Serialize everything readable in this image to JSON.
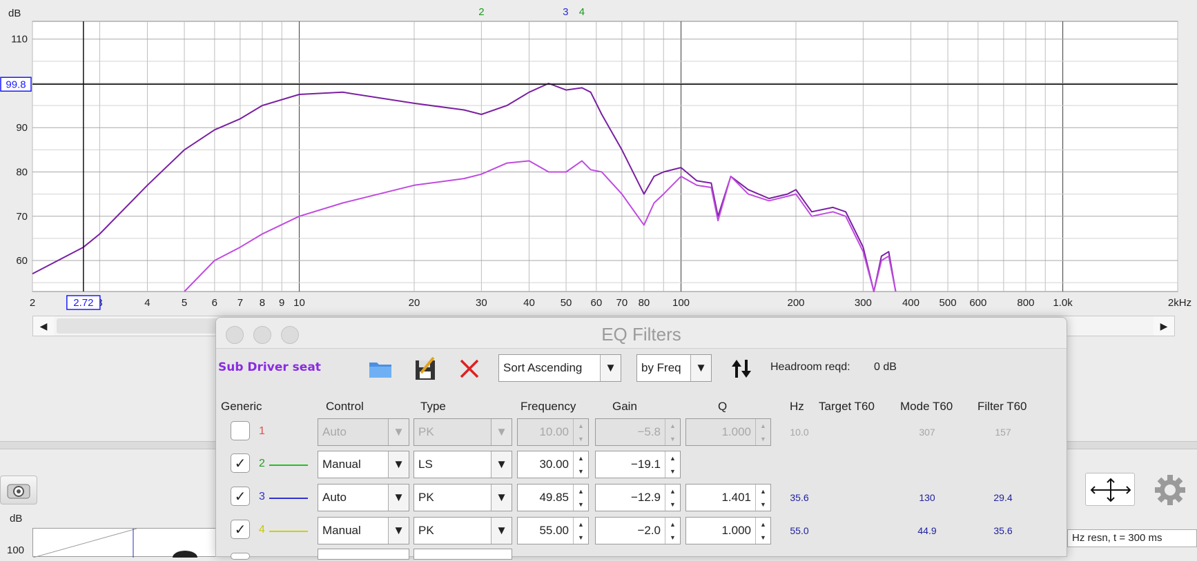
{
  "graph": {
    "y_unit": "dB",
    "y_ticks": [
      {
        "value": 110,
        "label": "110"
      },
      {
        "value": 90,
        "label": "90"
      },
      {
        "value": 80,
        "label": "80"
      },
      {
        "value": 70,
        "label": "70"
      },
      {
        "value": 60,
        "label": "60"
      }
    ],
    "y_cursor": "99.8",
    "x_ticks": [
      {
        "value": 2,
        "label": "2"
      },
      {
        "value": 3,
        "label": "3"
      },
      {
        "value": 4,
        "label": "4"
      },
      {
        "value": 5,
        "label": "5"
      },
      {
        "value": 6,
        "label": "6"
      },
      {
        "value": 7,
        "label": "7"
      },
      {
        "value": 8,
        "label": "8"
      },
      {
        "value": 9,
        "label": "9"
      },
      {
        "value": 10,
        "label": "10"
      },
      {
        "value": 20,
        "label": "20"
      },
      {
        "value": 30,
        "label": "30"
      },
      {
        "value": 40,
        "label": "40"
      },
      {
        "value": 50,
        "label": "50"
      },
      {
        "value": 60,
        "label": "60"
      },
      {
        "value": 70,
        "label": "70"
      },
      {
        "value": 80,
        "label": "80"
      },
      {
        "value": 100,
        "label": "100"
      },
      {
        "value": 200,
        "label": "200"
      },
      {
        "value": 300,
        "label": "300"
      },
      {
        "value": 400,
        "label": "400"
      },
      {
        "value": 500,
        "label": "500"
      },
      {
        "value": 600,
        "label": "600"
      },
      {
        "value": 800,
        "label": "800"
      },
      {
        "value": 1000,
        "label": "1.0k"
      },
      {
        "value": 2000,
        "label": "2kHz"
      }
    ],
    "x_cursor": "2.72",
    "filter_markers": [
      {
        "label": "2",
        "freq": 30,
        "color": "#1a9a1a"
      },
      {
        "label": "3",
        "freq": 49.85,
        "color": "#2a2acc"
      },
      {
        "label": "4",
        "freq": 55,
        "color": "#1a9a1a"
      }
    ],
    "colors": {
      "upper_trace": "#7a1fa2",
      "lower_trace": "#c04ae0"
    }
  },
  "chart_data": {
    "type": "line",
    "xlabel": "",
    "ylabel": "dB",
    "x_scale": "log",
    "xlim": [
      2,
      2000
    ],
    "ylim": [
      53,
      114
    ],
    "grid": true,
    "series": [
      {
        "values": [
          [
            2,
            57
          ],
          [
            2.72,
            63
          ],
          [
            3,
            66
          ],
          [
            4,
            77
          ],
          [
            5,
            85
          ],
          [
            6,
            89.5
          ],
          [
            7,
            92
          ],
          [
            8,
            95
          ],
          [
            10,
            97.5
          ],
          [
            13,
            98
          ],
          [
            20,
            95.5
          ],
          [
            27,
            94
          ],
          [
            30,
            93
          ],
          [
            35,
            95
          ],
          [
            40,
            98
          ],
          [
            45,
            100
          ],
          [
            50,
            98.5
          ],
          [
            55,
            99
          ],
          [
            58,
            98
          ],
          [
            62,
            93
          ],
          [
            70,
            85
          ],
          [
            80,
            75
          ],
          [
            85,
            79
          ],
          [
            90,
            80
          ],
          [
            100,
            81
          ],
          [
            110,
            78
          ],
          [
            120,
            77.5
          ],
          [
            125,
            70
          ],
          [
            135,
            79
          ],
          [
            150,
            76
          ],
          [
            170,
            74
          ],
          [
            190,
            75
          ],
          [
            200,
            76
          ],
          [
            220,
            71
          ],
          [
            250,
            72
          ],
          [
            270,
            71
          ],
          [
            300,
            63
          ],
          [
            320,
            53
          ],
          [
            335,
            61
          ],
          [
            350,
            62
          ],
          [
            365,
            53
          ]
        ]
      },
      {
        "values": [
          [
            5,
            53
          ],
          [
            6,
            60
          ],
          [
            7,
            63
          ],
          [
            8,
            66
          ],
          [
            10,
            70
          ],
          [
            13,
            73
          ],
          [
            20,
            77
          ],
          [
            27,
            78.5
          ],
          [
            30,
            79.5
          ],
          [
            35,
            82
          ],
          [
            40,
            82.5
          ],
          [
            45,
            80
          ],
          [
            50,
            80
          ],
          [
            55,
            82.5
          ],
          [
            58,
            80.5
          ],
          [
            62,
            80
          ],
          [
            70,
            75
          ],
          [
            80,
            68
          ],
          [
            85,
            73
          ],
          [
            90,
            75
          ],
          [
            100,
            79
          ],
          [
            110,
            77
          ],
          [
            120,
            76.5
          ],
          [
            125,
            69
          ],
          [
            135,
            79
          ],
          [
            150,
            75
          ],
          [
            170,
            73.5
          ],
          [
            190,
            74.5
          ],
          [
            200,
            75
          ],
          [
            220,
            70
          ],
          [
            250,
            71
          ],
          [
            270,
            70
          ],
          [
            300,
            62
          ],
          [
            320,
            53
          ],
          [
            335,
            60
          ],
          [
            350,
            61
          ],
          [
            365,
            53
          ]
        ]
      }
    ]
  },
  "dialog": {
    "title": "EQ Filters",
    "measurement_name": "Sub Driver seat",
    "sort_order": "Sort Ascending",
    "sort_by": "by Freq",
    "headroom_label": "Headroom reqd:",
    "headroom_value": "0 dB",
    "headers": {
      "generic": "Generic",
      "control": "Control",
      "type": "Type",
      "frequency": "Frequency",
      "gain": "Gain",
      "q": "Q",
      "hz": "Hz",
      "target_t60": "Target T60",
      "mode_t60": "Mode T60",
      "filter_t60": "Filter T60"
    },
    "filters": [
      {
        "num": "1",
        "checked": false,
        "line_color": "",
        "num_color": "#e05050",
        "control": "Auto",
        "type": "PK",
        "frequency": "10.00",
        "gain": "−5.8",
        "q": "1.000",
        "hz": "10.0",
        "target_t60": "",
        "mode_t60": "307",
        "filter_t60": "157",
        "disabled": true
      },
      {
        "num": "2",
        "checked": true,
        "line_color": "#22c022",
        "num_color": "#22a022",
        "control": "Manual",
        "type": "LS",
        "frequency": "30.00",
        "gain": "−19.1",
        "q": "",
        "hz": "",
        "target_t60": "",
        "mode_t60": "",
        "filter_t60": "",
        "disabled": false
      },
      {
        "num": "3",
        "checked": true,
        "line_color": "#3030d0",
        "num_color": "#3030d0",
        "control": "Auto",
        "type": "PK",
        "frequency": "49.85",
        "gain": "−12.9",
        "q": "1.401",
        "hz": "35.6",
        "target_t60": "",
        "mode_t60": "130",
        "filter_t60": "29.4",
        "disabled": false
      },
      {
        "num": "4",
        "checked": true,
        "line_color": "#d0d000",
        "num_color": "#c8c800",
        "control": "Manual",
        "type": "PK",
        "frequency": "55.00",
        "gain": "−2.0",
        "q": "1.000",
        "hz": "55.0",
        "target_t60": "",
        "mode_t60": "44.9",
        "filter_t60": "35.6",
        "disabled": false
      }
    ]
  },
  "lower": {
    "y_unit": "dB",
    "y_tick": "100",
    "resolution_text": "Hz resn, t = 300 ms"
  },
  "icons": {
    "folder": "folder-open-icon",
    "save": "save-icon",
    "clear": "delete-icon",
    "swap": "swap-vertical-icon",
    "camera": "camera-icon",
    "nav": "move-arrows-icon",
    "settings": "gear-icon"
  }
}
